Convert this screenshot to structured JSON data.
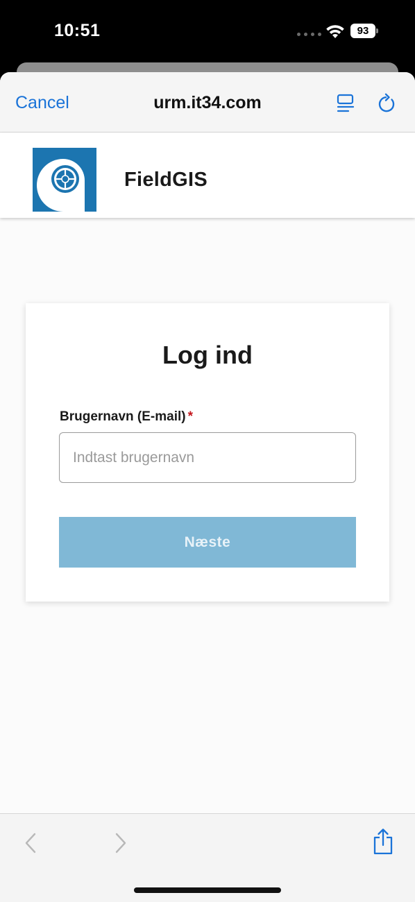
{
  "status_bar": {
    "time": "10:51",
    "battery": "93",
    "signal_icon": "cellular-signal-icon",
    "wifi_icon": "wifi-icon"
  },
  "browser": {
    "cancel_label": "Cancel",
    "url": "urm.it34.com",
    "reader_icon": "reader-mode-icon",
    "reload_icon": "reload-icon",
    "accent_color": "#1a73d8"
  },
  "header": {
    "logo_icon": "fieldgis-logo-icon",
    "app_name": "FieldGIS",
    "brand_color": "#1c75b0"
  },
  "login": {
    "title": "Log ind",
    "username_label": "Brugernavn (E-mail)",
    "required_marker": "*",
    "username_value": "",
    "username_placeholder": "Indtast brugernavn",
    "next_label": "Næste",
    "next_color": "#80b8d6"
  },
  "toolbar": {
    "back_icon": "chevron-left-icon",
    "forward_icon": "chevron-right-icon",
    "share_icon": "share-icon"
  }
}
